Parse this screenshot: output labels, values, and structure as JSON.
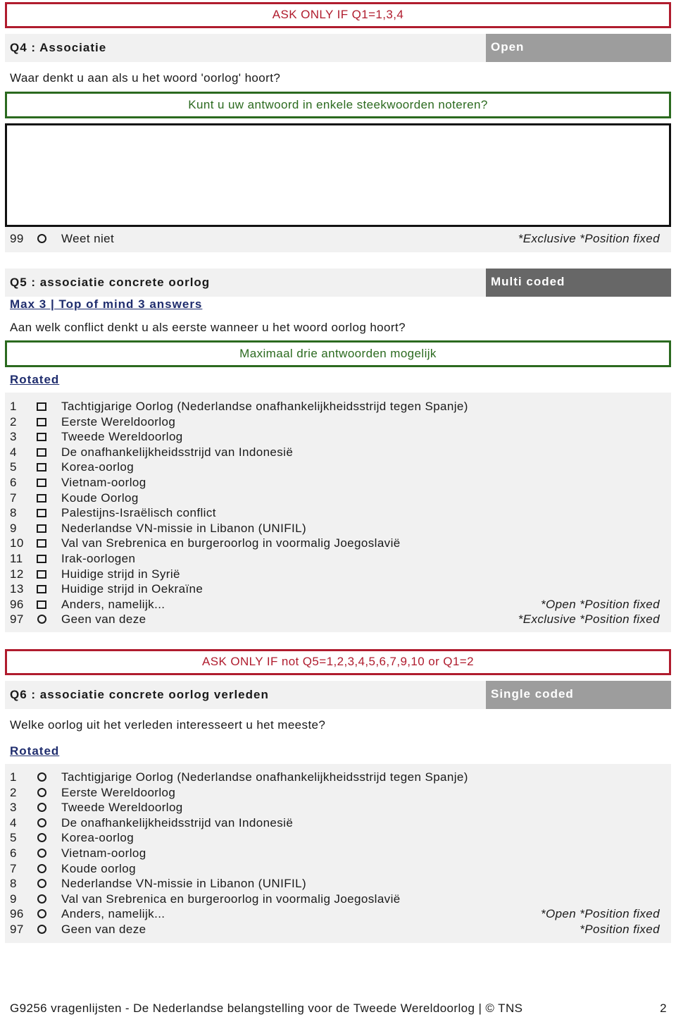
{
  "q4": {
    "condition": "ASK ONLY IF Q1=1,3,4",
    "title": "Q4 : Associatie",
    "type": "Open",
    "question": "Waar denkt u aan als u het woord 'oorlog' hoort?",
    "instruction": "Kunt u uw antwoord in enkele steekwoorden noteren?",
    "open_answer_value": "",
    "answers": [
      {
        "code": "99",
        "mark": "radio",
        "label": "Weet niet",
        "note": "*Exclusive *Position fixed"
      }
    ]
  },
  "q5": {
    "title": "Q5 : associatie concrete oorlog",
    "type": "Multi coded",
    "max_link": "Max 3 | Top of mind 3 answers",
    "question": "Aan welk conflict denkt u als eerste wanneer u het woord oorlog hoort?",
    "instruction": "Maximaal drie antwoorden mogelijk",
    "rotated_link": "Rotated",
    "answers": [
      {
        "code": "1",
        "mark": "box",
        "label": "Tachtigjarige Oorlog (Nederlandse onafhankelijkheidsstrijd tegen Spanje)",
        "note": ""
      },
      {
        "code": "2",
        "mark": "box",
        "label": "Eerste Wereldoorlog",
        "note": ""
      },
      {
        "code": "3",
        "mark": "box",
        "label": "Tweede Wereldoorlog",
        "note": ""
      },
      {
        "code": "4",
        "mark": "box",
        "label": "De onafhankelijkheidsstrijd van Indonesië",
        "note": ""
      },
      {
        "code": "5",
        "mark": "box",
        "label": "Korea-oorlog",
        "note": ""
      },
      {
        "code": "6",
        "mark": "box",
        "label": "Vietnam-oorlog",
        "note": ""
      },
      {
        "code": "7",
        "mark": "box",
        "label": "Koude Oorlog",
        "note": ""
      },
      {
        "code": "8",
        "mark": "box",
        "label": "Palestijns-Israëlisch conflict",
        "note": ""
      },
      {
        "code": "9",
        "mark": "box",
        "label": "Nederlandse VN-missie in Libanon (UNIFIL)",
        "note": ""
      },
      {
        "code": "10",
        "mark": "box",
        "label": "Val van Srebrenica en burgeroorlog in voormalig Joegoslavië",
        "note": ""
      },
      {
        "code": "11",
        "mark": "box",
        "label": "Irak-oorlogen",
        "note": ""
      },
      {
        "code": "12",
        "mark": "box",
        "label": "Huidige strijd in Syrië",
        "note": ""
      },
      {
        "code": "13",
        "mark": "box",
        "label": "Huidige strijd in Oekraïne",
        "note": ""
      },
      {
        "code": "96",
        "mark": "box",
        "label": "Anders, namelijk...",
        "note": "*Open *Position fixed"
      },
      {
        "code": "97",
        "mark": "radio",
        "label": "Geen van deze",
        "note": "*Exclusive *Position fixed"
      }
    ]
  },
  "q6": {
    "condition": "ASK ONLY IF not Q5=1,2,3,4,5,6,7,9,10 or Q1=2",
    "title": "Q6 : associatie concrete oorlog verleden",
    "type": "Single coded",
    "question": "Welke oorlog uit het verleden interesseert u het meeste?",
    "rotated_link": "Rotated",
    "answers": [
      {
        "code": "1",
        "mark": "radio",
        "label": "Tachtigjarige Oorlog (Nederlandse onafhankelijkheidsstrijd tegen Spanje)",
        "note": ""
      },
      {
        "code": "2",
        "mark": "radio",
        "label": "Eerste Wereldoorlog",
        "note": ""
      },
      {
        "code": "3",
        "mark": "radio",
        "label": "Tweede Wereldoorlog",
        "note": ""
      },
      {
        "code": "4",
        "mark": "radio",
        "label": "De onafhankelijkheidsstrijd van Indonesië",
        "note": ""
      },
      {
        "code": "5",
        "mark": "radio",
        "label": "Korea-oorlog",
        "note": ""
      },
      {
        "code": "6",
        "mark": "radio",
        "label": "Vietnam-oorlog",
        "note": ""
      },
      {
        "code": "7",
        "mark": "radio",
        "label": "Koude oorlog",
        "note": ""
      },
      {
        "code": "8",
        "mark": "radio",
        "label": "Nederlandse VN-missie in Libanon (UNIFIL)",
        "note": ""
      },
      {
        "code": "9",
        "mark": "radio",
        "label": "Val van Srebrenica en burgeroorlog in voormalig Joegoslavië",
        "note": ""
      },
      {
        "code": "96",
        "mark": "radio",
        "label": "Anders, namelijk...",
        "note": "*Open *Position fixed"
      },
      {
        "code": "97",
        "mark": "radio",
        "label": "Geen van deze",
        "note": "*Position fixed"
      }
    ]
  },
  "footer": {
    "text": "G9256 vragenlijsten - De Nederlandse belangstelling voor de Tweede Wereldoorlog | © TNS",
    "page_number": "2"
  },
  "colors": {
    "condition_red": "#b01c2e",
    "instruction_green": "#2b6a1f",
    "link_navy": "#1f2d6e",
    "type_badge_light": "#9d9d9d",
    "type_badge_dark": "#676767",
    "row_background": "#f1f1f1"
  }
}
